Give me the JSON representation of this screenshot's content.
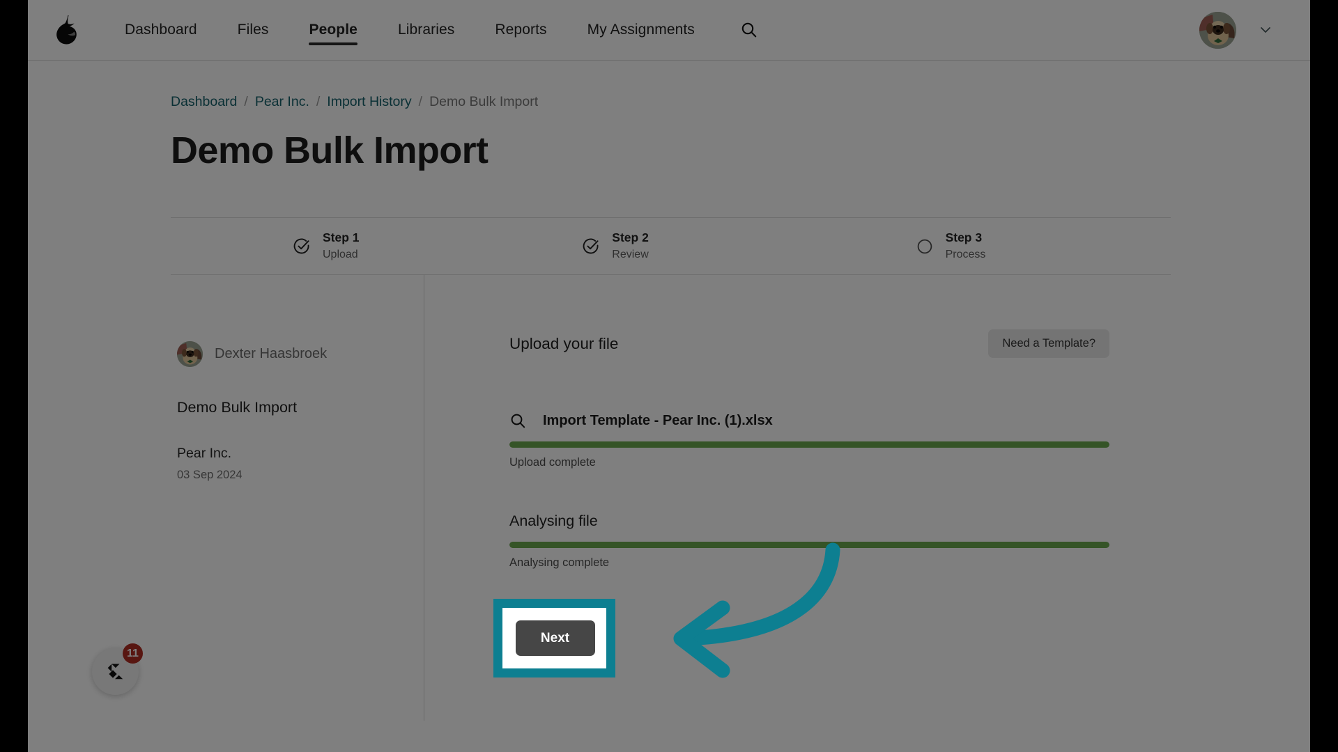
{
  "nav": {
    "brand_icon": "pear-logo-icon",
    "links": [
      {
        "label": "Dashboard",
        "active": false
      },
      {
        "label": "Files",
        "active": false
      },
      {
        "label": "People",
        "active": true
      },
      {
        "label": "Libraries",
        "active": false
      },
      {
        "label": "Reports",
        "active": false
      },
      {
        "label": "My Assignments",
        "active": false
      }
    ],
    "search_icon": "search-icon",
    "account_caret_icon": "chevron-down-icon",
    "avatar_icon": "user-avatar-dog"
  },
  "breadcrumb": {
    "items": [
      {
        "label": "Dashboard",
        "type": "link"
      },
      {
        "label": "Pear Inc.",
        "type": "link"
      },
      {
        "label": "Import History",
        "type": "link"
      },
      {
        "label": "Demo Bulk Import",
        "type": "current"
      }
    ],
    "separator": "/"
  },
  "page": {
    "title": "Demo Bulk Import"
  },
  "stepper": {
    "steps": [
      {
        "label": "Step 1",
        "sub": "Upload",
        "icon": "check-circle-icon",
        "state": "complete"
      },
      {
        "label": "Step 2",
        "sub": "Review",
        "icon": "check-circle-icon",
        "state": "complete"
      },
      {
        "label": "Step 3",
        "sub": "Process",
        "icon": "circle-icon",
        "state": "pending"
      }
    ]
  },
  "sidebar": {
    "user_name": "Dexter Haasbroek",
    "import_title": "Demo Bulk Import",
    "organisation": "Pear Inc.",
    "date": "03 Sep 2024"
  },
  "main": {
    "upload_heading": "Upload your file",
    "template_button": "Need a Template?",
    "file": {
      "icon": "search-icon",
      "name": "Import Template - Pear Inc. (1).xlsx",
      "progress_percent": 100,
      "status": "Upload complete"
    },
    "analyse": {
      "heading": "Analysing file",
      "progress_percent": 100,
      "status": "Analysing complete"
    },
    "next_button": "Next"
  },
  "chat": {
    "icon": "chat-widget-icon",
    "unread_count": "11"
  },
  "colors": {
    "accent_teal": "#0d7f91",
    "progress_green": "#6aa84f",
    "link_teal": "#15606b",
    "badge_red": "#b02c23",
    "button_dark": "#464646"
  }
}
